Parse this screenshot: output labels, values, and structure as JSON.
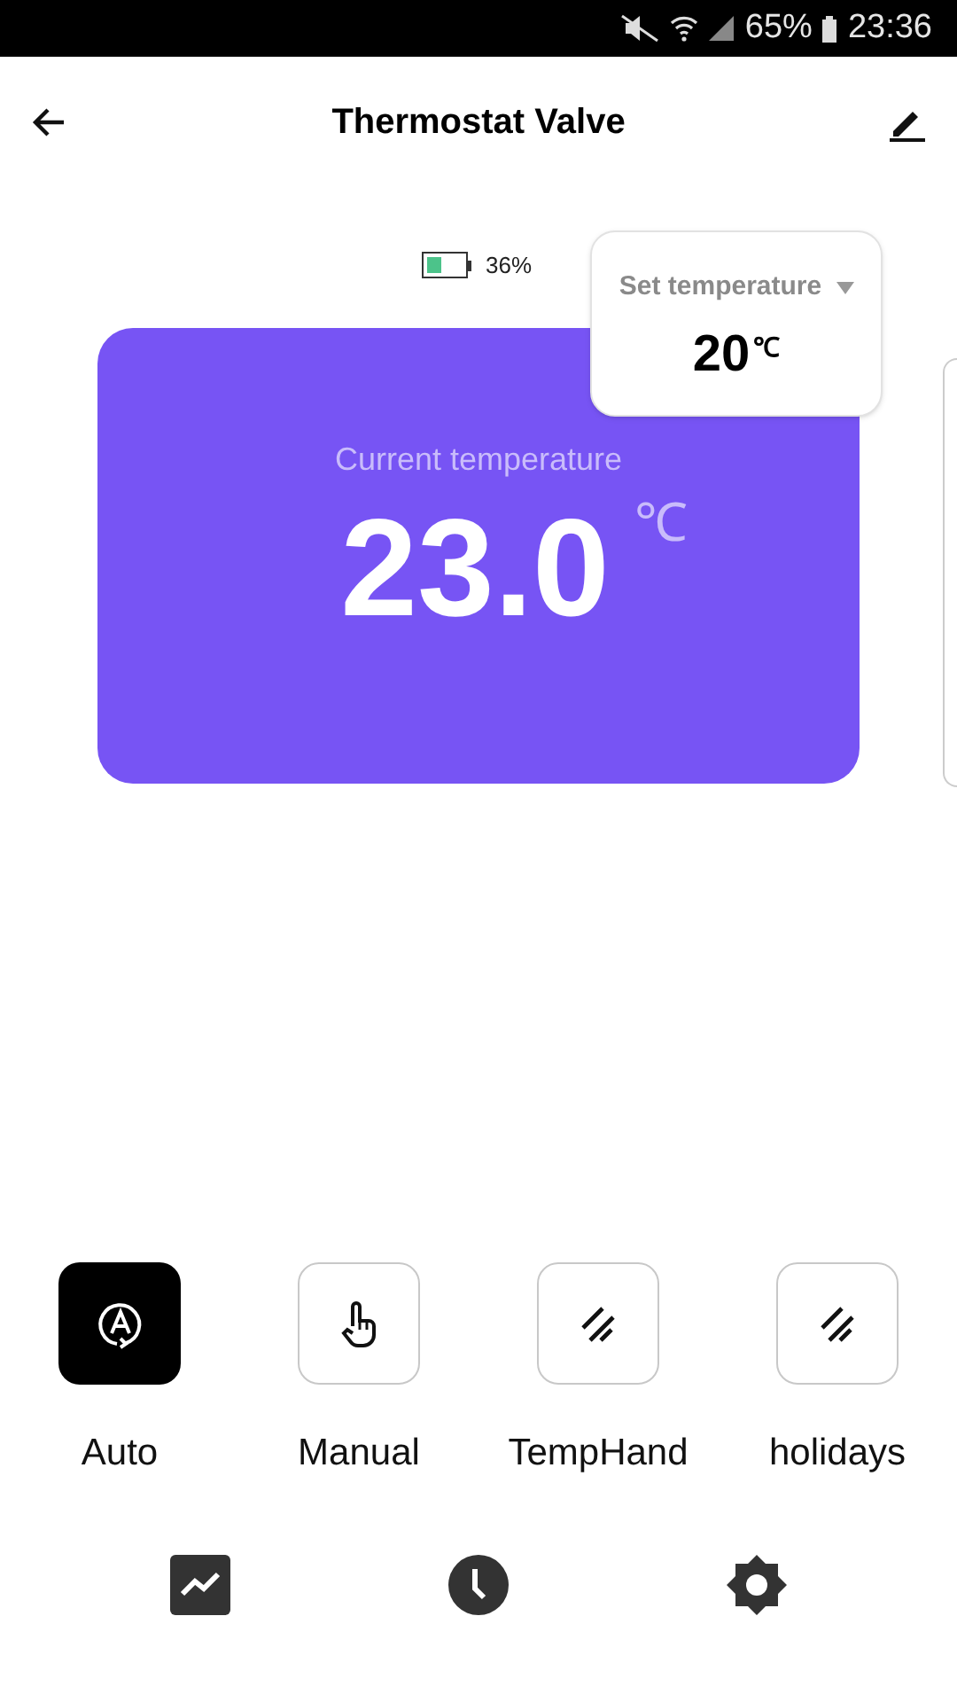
{
  "status_bar": {
    "battery": "65%",
    "time": "23:36"
  },
  "header": {
    "title": "Thermostat Valve"
  },
  "device_battery": {
    "reading": "36%"
  },
  "set_temperature": {
    "label": "Set temperature",
    "value": "20",
    "unit": "℃"
  },
  "current_temperature": {
    "label": "Current temperature",
    "value": "23.0",
    "unit": "℃"
  },
  "modes": [
    {
      "kind": "auto",
      "label": "Auto",
      "selected": true
    },
    {
      "kind": "manual",
      "label": "Manual",
      "selected": false
    },
    {
      "kind": "lines",
      "label": "TempHand",
      "selected": false
    },
    {
      "kind": "lines",
      "label": "holidays",
      "selected": false
    }
  ]
}
